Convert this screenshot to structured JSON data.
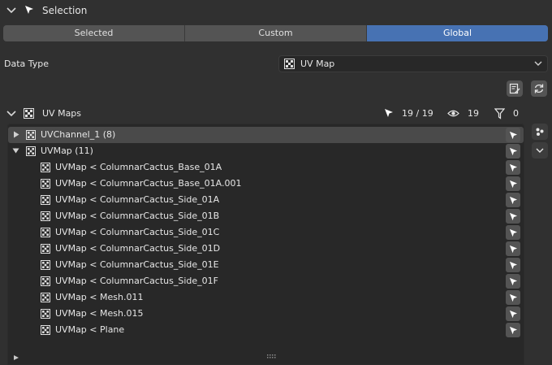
{
  "panel": {
    "title": "Selection"
  },
  "scope": {
    "options": [
      "Selected",
      "Custom",
      "Global"
    ],
    "active": "Global"
  },
  "data_type": {
    "label": "Data Type",
    "value": "UV Map"
  },
  "uv_maps": {
    "title": "UV Maps",
    "selected_count": "19 / 19",
    "visible_count": "19",
    "filtered_count": "0"
  },
  "tree": [
    {
      "label": "UVChannel_1 (8)",
      "expanded": false,
      "depth": 0,
      "selected": true
    },
    {
      "label": "UVMap (11)",
      "expanded": true,
      "depth": 0,
      "selected": false
    },
    {
      "label": "UVMap < ColumnarCactus_Base_01A",
      "depth": 1
    },
    {
      "label": "UVMap < ColumnarCactus_Base_01A.001",
      "depth": 1
    },
    {
      "label": "UVMap < ColumnarCactus_Side_01A",
      "depth": 1
    },
    {
      "label": "UVMap < ColumnarCactus_Side_01B",
      "depth": 1
    },
    {
      "label": "UVMap < ColumnarCactus_Side_01C",
      "depth": 1
    },
    {
      "label": "UVMap < ColumnarCactus_Side_01D",
      "depth": 1
    },
    {
      "label": "UVMap < ColumnarCactus_Side_01E",
      "depth": 1
    },
    {
      "label": "UVMap < ColumnarCactus_Side_01F",
      "depth": 1
    },
    {
      "label": "UVMap < Mesh.011",
      "depth": 1
    },
    {
      "label": "UVMap < Mesh.015",
      "depth": 1
    },
    {
      "label": "UVMap < Plane",
      "depth": 1
    }
  ],
  "icons": {
    "collapse": "chevron-down-icon",
    "cursor": "select-cursor-icon",
    "uv": "uv-checker-icon",
    "edit": "edit-note-icon",
    "refresh": "refresh-icon",
    "eye": "eye-icon",
    "filter": "filter-icon"
  },
  "colors": {
    "accent": "#4772b3",
    "bg": "#303030",
    "list_bg": "#282828",
    "selected_row": "#4a4a4a"
  }
}
